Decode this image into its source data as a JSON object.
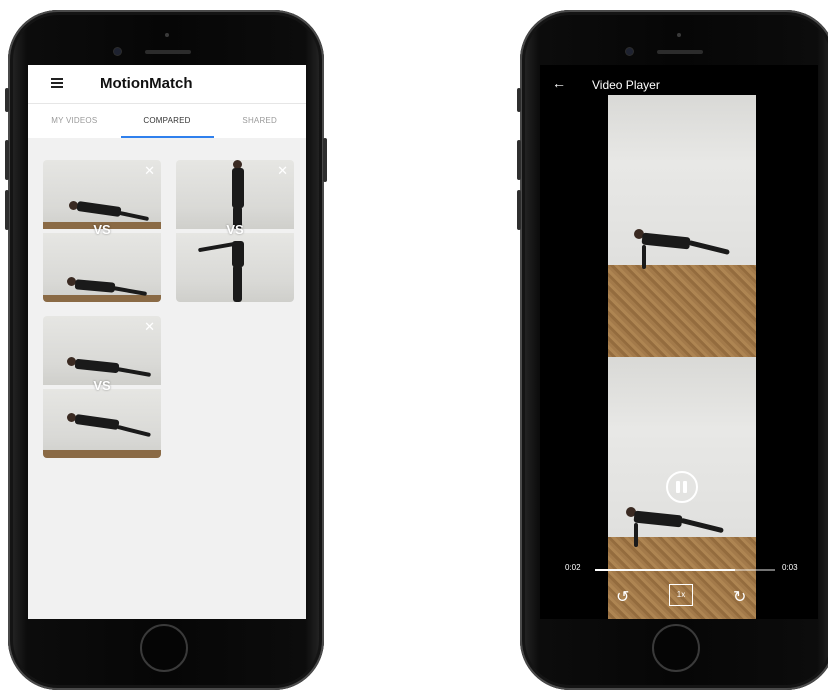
{
  "left_app": {
    "title": "MotionMatch",
    "tabs": [
      {
        "label": "MY VIDEOS",
        "active": false
      },
      {
        "label": "COMPARED",
        "active": true
      },
      {
        "label": "SHARED",
        "active": false
      }
    ],
    "comparisons": [
      {
        "vs_label": "VS",
        "close_icon": "close-icon"
      },
      {
        "vs_label": "VS",
        "close_icon": "close-icon"
      },
      {
        "vs_label": "VS",
        "close_icon": "close-icon"
      }
    ],
    "accent_color": "#2f80ed"
  },
  "right_app": {
    "title": "Video Player",
    "time_current": "0:02",
    "time_total": "0:03",
    "progress_fraction": 0.78,
    "speed_label": "1x",
    "controls": [
      "replay-10-icon",
      "pause-icon",
      "forward-icon"
    ]
  },
  "icons": {
    "menu": "≡",
    "back": "←",
    "close": "✕",
    "replay": "↺",
    "forward": "↻"
  }
}
